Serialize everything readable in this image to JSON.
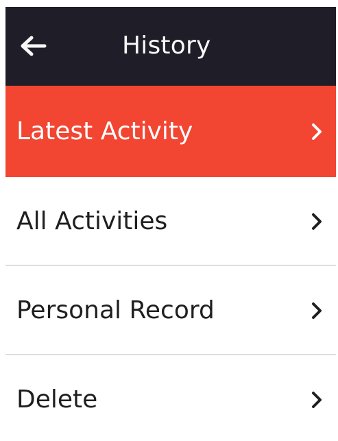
{
  "header": {
    "title": "History",
    "back_icon": "arrow-left-icon",
    "background_color": "#1f1d27",
    "text_color": "#f7f7f7"
  },
  "menu": {
    "active_color": "#f24532",
    "items": [
      {
        "label": "Latest Activity",
        "icon": "chevron-right-icon",
        "active": true
      },
      {
        "label": "All Activities",
        "icon": "chevron-right-icon",
        "active": false
      },
      {
        "label": "Personal Record",
        "icon": "chevron-right-icon",
        "active": false
      },
      {
        "label": "Delete",
        "icon": "chevron-right-icon",
        "active": false
      }
    ]
  }
}
